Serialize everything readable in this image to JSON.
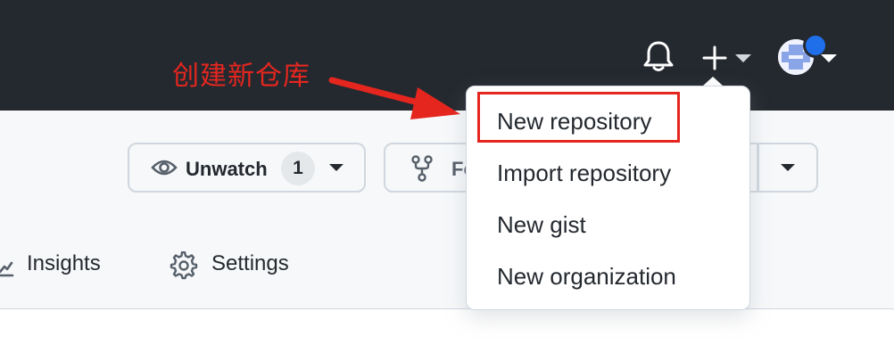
{
  "annotation": {
    "text": "创建新仓库"
  },
  "header": {
    "bell_icon": "bell-icon",
    "plus_icon": "plus-icon",
    "caret_icon": "caret-down-icon",
    "avatar_icon": "avatar"
  },
  "repo_actions": {
    "unwatch": {
      "label": "Unwatch",
      "count": "1"
    },
    "fork": {
      "label": "Fo"
    }
  },
  "tabs": [
    {
      "label": "Insights",
      "icon": "graph-icon"
    },
    {
      "label": "Settings",
      "icon": "gear-icon"
    }
  ],
  "create_menu": {
    "items": [
      {
        "label": "New repository"
      },
      {
        "label": "Import repository"
      },
      {
        "label": "New gist"
      },
      {
        "label": "New organization"
      }
    ]
  },
  "colors": {
    "header_bg": "#24292f",
    "annotation_red": "#e5261f",
    "notification_blue": "#1f6feb"
  }
}
